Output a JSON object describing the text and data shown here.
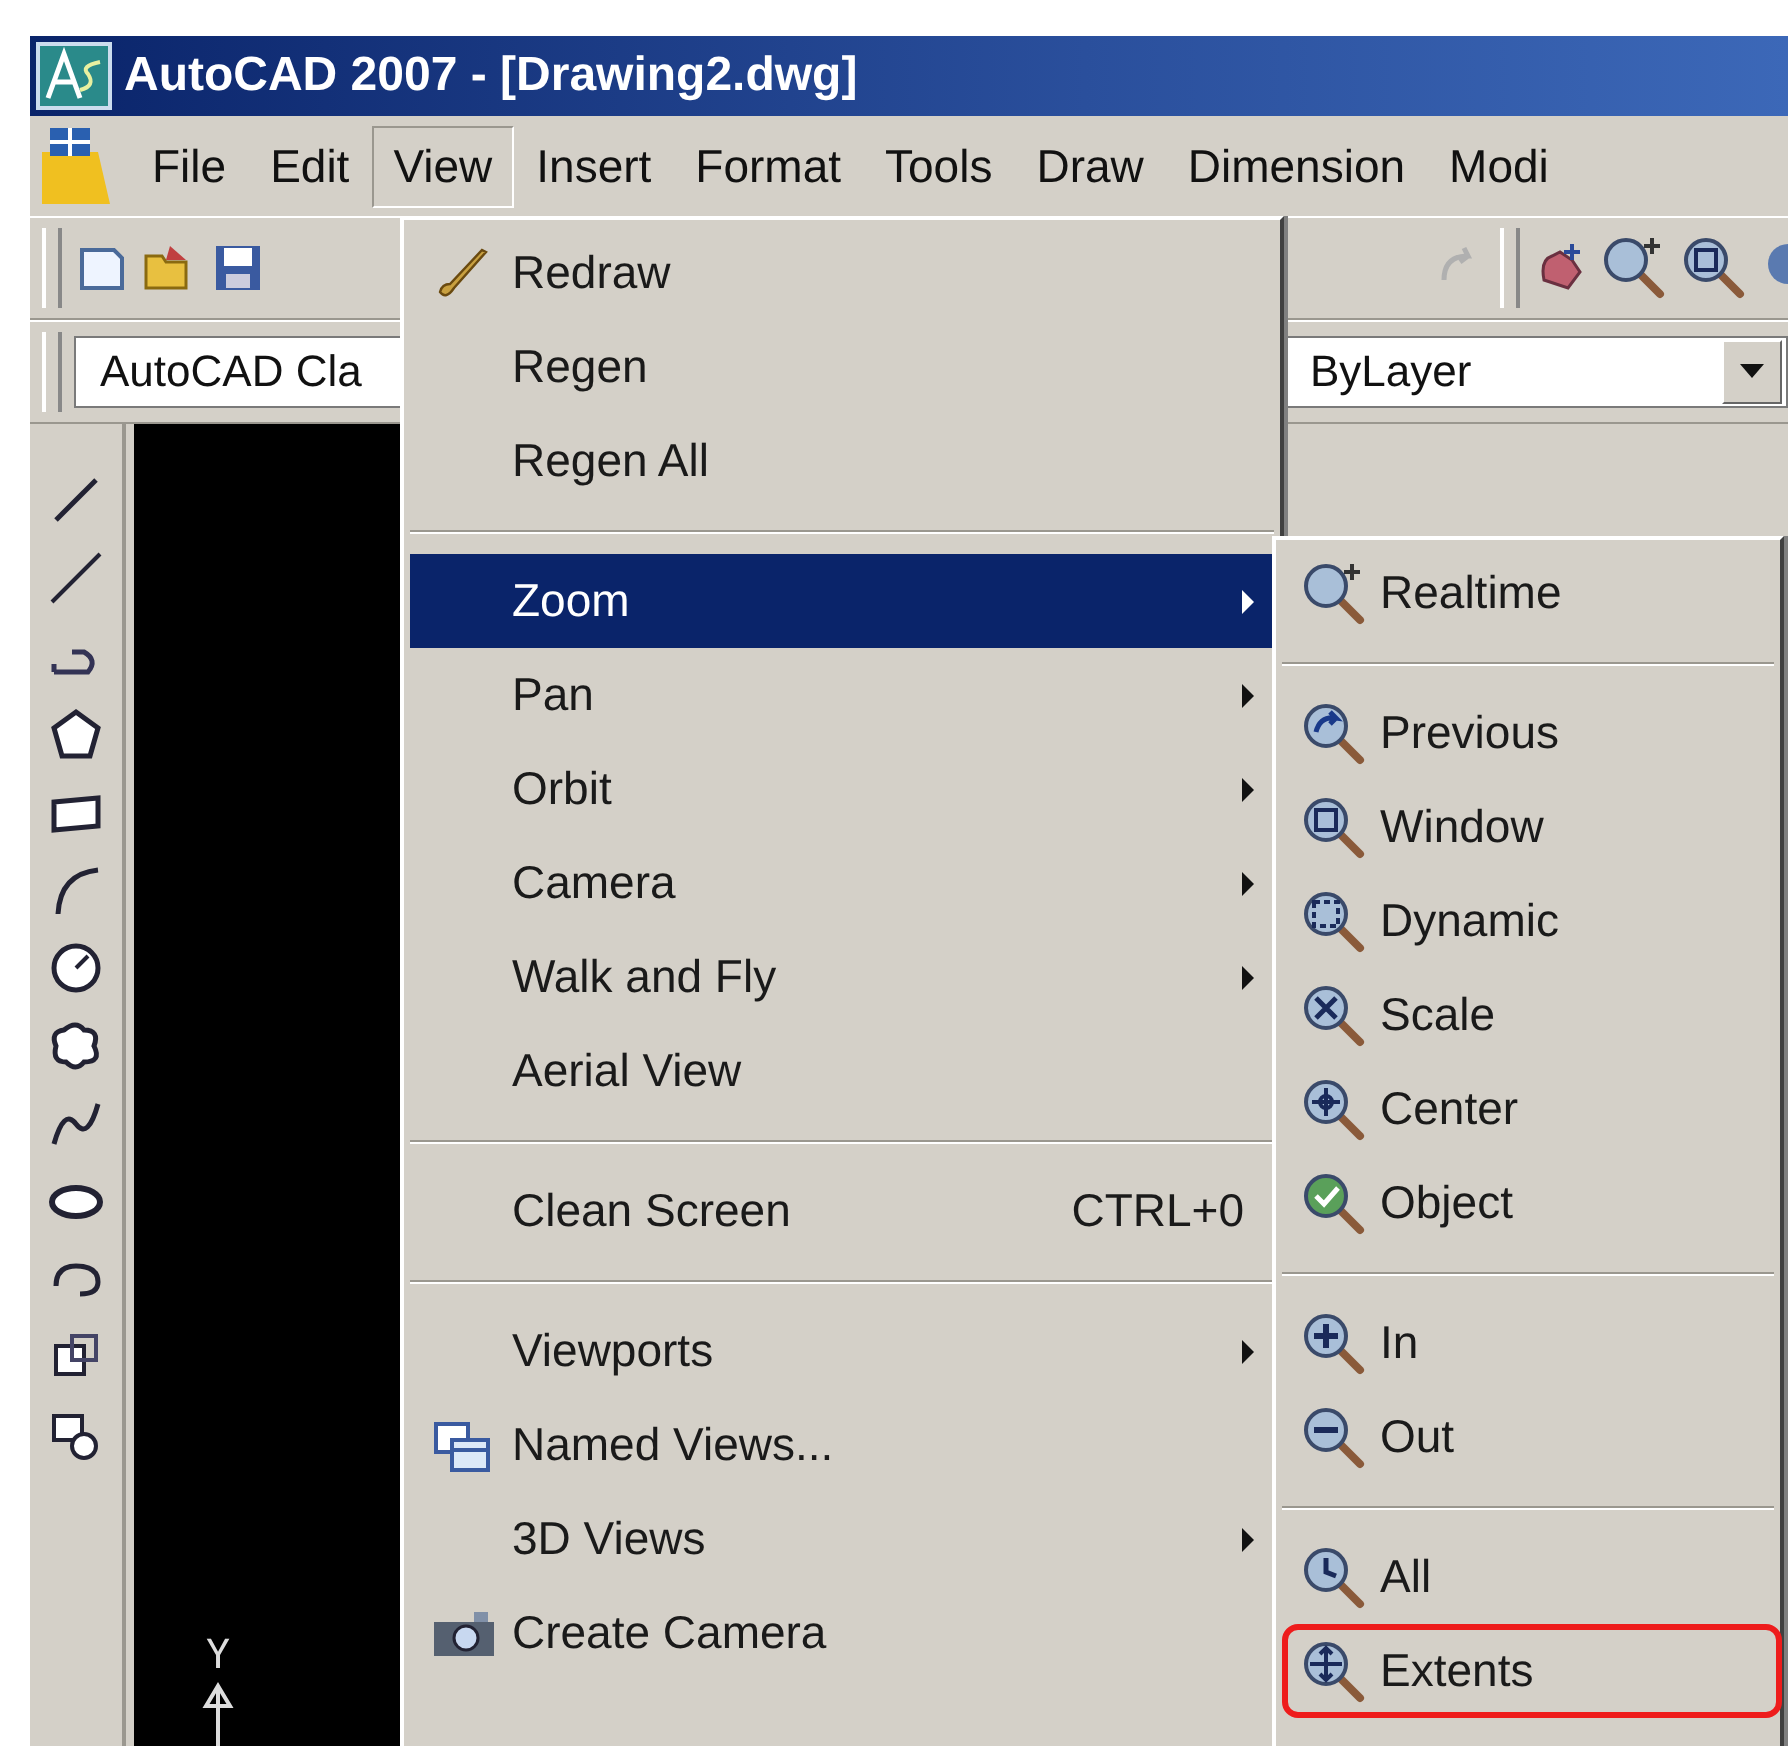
{
  "window": {
    "title": "AutoCAD 2007 - [Drawing2.dwg]"
  },
  "menu_bar": [
    {
      "label": "File",
      "selected": false
    },
    {
      "label": "Edit",
      "selected": false
    },
    {
      "label": "View",
      "selected": true
    },
    {
      "label": "Insert",
      "selected": false
    },
    {
      "label": "Format",
      "selected": false
    },
    {
      "label": "Tools",
      "selected": false
    },
    {
      "label": "Draw",
      "selected": false
    },
    {
      "label": "Dimension",
      "selected": false
    },
    {
      "label": "Modi",
      "selected": false
    }
  ],
  "style_toolbar": {
    "workspace_value": "AutoCAD Cla",
    "linetype_value": "ByLayer"
  },
  "drawing_area": {
    "ucs_axis_label": "Y"
  },
  "view_menu": {
    "sections": [
      {
        "items": [
          {
            "label": "Redraw",
            "selected": false,
            "submenu": false
          },
          {
            "label": "Regen",
            "selected": false,
            "submenu": false
          },
          {
            "label": "Regen All",
            "selected": false,
            "submenu": false
          }
        ]
      },
      {
        "items": [
          {
            "label": "Zoom",
            "selected": true,
            "submenu": true
          },
          {
            "label": "Pan",
            "selected": false,
            "submenu": true
          },
          {
            "label": "Orbit",
            "selected": false,
            "submenu": true
          },
          {
            "label": "Camera",
            "selected": false,
            "submenu": true
          },
          {
            "label": "Walk and Fly",
            "selected": false,
            "submenu": true
          },
          {
            "label": "Aerial View",
            "selected": false,
            "submenu": false
          }
        ]
      },
      {
        "items": [
          {
            "label": "Clean Screen",
            "shortcut": "CTRL+0",
            "selected": false,
            "submenu": false
          }
        ]
      },
      {
        "items": [
          {
            "label": "Viewports",
            "selected": false,
            "submenu": true
          },
          {
            "label": "Named Views...",
            "selected": false,
            "submenu": false
          },
          {
            "label": "3D Views",
            "selected": false,
            "submenu": true
          },
          {
            "label": "Create Camera",
            "selected": false,
            "submenu": false
          }
        ]
      }
    ]
  },
  "zoom_submenu": {
    "sections": [
      {
        "items": [
          {
            "label": "Realtime",
            "highlighted": false
          }
        ]
      },
      {
        "items": [
          {
            "label": "Previous",
            "highlighted": false
          },
          {
            "label": "Window",
            "highlighted": false
          },
          {
            "label": "Dynamic",
            "highlighted": false
          },
          {
            "label": "Scale",
            "highlighted": false
          },
          {
            "label": "Center",
            "highlighted": false
          },
          {
            "label": "Object",
            "highlighted": false
          }
        ]
      },
      {
        "items": [
          {
            "label": "In",
            "highlighted": false
          },
          {
            "label": "Out",
            "highlighted": false
          }
        ]
      },
      {
        "items": [
          {
            "label": "All",
            "highlighted": false
          },
          {
            "label": "Extents",
            "highlighted": true
          }
        ]
      }
    ]
  }
}
